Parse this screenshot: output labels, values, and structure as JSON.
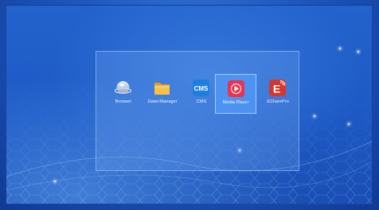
{
  "launcher": {
    "apps": [
      {
        "label": "Browser",
        "icon": "browser-icon",
        "selected": false
      },
      {
        "label": "Datei-Manager",
        "icon": "file-manager-icon",
        "selected": false
      },
      {
        "label": "CMS",
        "icon": "cms-icon",
        "selected": false
      },
      {
        "label": "Media Player",
        "icon": "media-player-icon",
        "selected": true
      },
      {
        "label": "ESharePro",
        "icon": "eshare-icon",
        "selected": false
      }
    ],
    "cms_icon_text": "CMS",
    "eshare_icon_text": "E"
  },
  "colors": {
    "background": "#1d59c4",
    "selected_tile": "#4f96f5",
    "cms_icon": "#1f7fe0",
    "media_player_icon": "#e8344e",
    "eshare_icon": "#d6372c",
    "folder_icon": "#f5b53a"
  }
}
